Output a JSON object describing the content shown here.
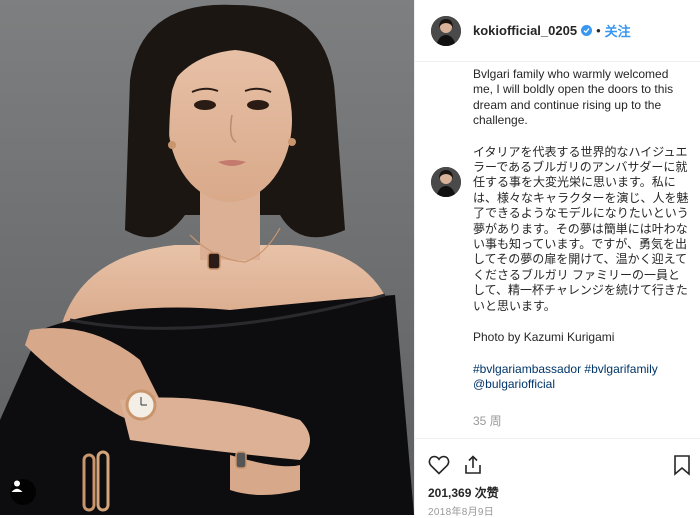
{
  "post": {
    "photo_alt": "Portrait photo",
    "user_tag_icon": "user-tag-icon"
  },
  "header": {
    "username": "kokiofficial_0205",
    "verified": true,
    "separator": "•",
    "follow_label": "关注"
  },
  "caption": {
    "english": "Bvlgari family who warmly welcomed me, I will boldly open the doors to this dream and continue rising up to the challenge.",
    "japanese": "イタリアを代表する世界的なハイジュエラーであるブルガリのアンバサダーに就任する事を大変光栄に思います。私には、様々なキャラクターを演じ、人を魅了できるようなモデルになりたいという夢があります。その夢は簡単には叶わない事も知っています。ですが、勇気を出してその夢の扉を開けて、温かく迎えてくださるブルガリ ファミリーの一員として、精一杯チャレンジを続けて行きたいと思います。",
    "photo_credit": "Photo by Kazumi Kurigami",
    "hashtags": [
      "#bvlgariambassador",
      "#bvlgarifamily"
    ],
    "mention": "@bulgariofficial",
    "time_ago": "35 周"
  },
  "actions": {
    "like_icon": "heart-icon",
    "share_icon": "share-icon",
    "save_icon": "bookmark-icon",
    "likes": "201,369 次赞",
    "date": "2018年8月9日"
  },
  "colors": {
    "accent": "#3897f0",
    "link": "#003569",
    "muted": "#999999",
    "border": "#efefef"
  }
}
